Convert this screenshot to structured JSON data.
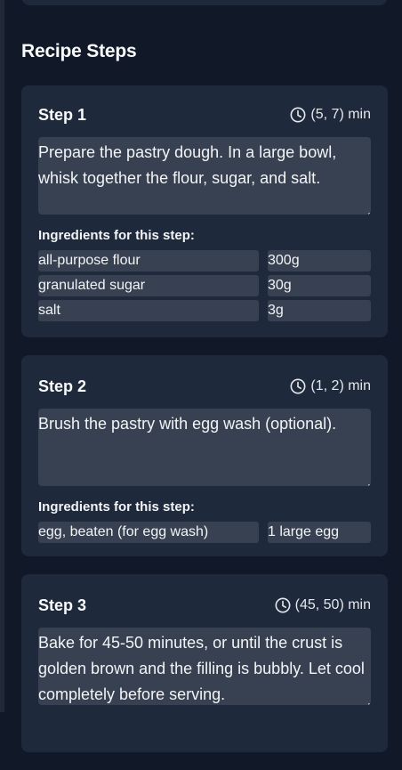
{
  "recipe_steps": {
    "title": "Recipe Steps",
    "ingredients_heading": "Ingredients for this step:",
    "steps": [
      {
        "title": "Step 1",
        "time": "(5, 7) min",
        "description": "Prepare the pastry dough. In a large bowl, whisk together the flour, sugar, and salt.",
        "ingredients": [
          {
            "name": "all-purpose flour",
            "quantity": "300g"
          },
          {
            "name": "granulated sugar",
            "quantity": "30g"
          },
          {
            "name": "salt",
            "quantity": "3g"
          }
        ]
      },
      {
        "title": "Step 2",
        "time": "(1, 2) min",
        "description": "Brush the pastry with egg wash (optional).",
        "ingredients": [
          {
            "name": "egg, beaten (for egg wash)",
            "quantity": "1 large egg"
          }
        ]
      },
      {
        "title": "Step 3",
        "time": "(45, 50) min",
        "description": "Bake for 45-50 minutes, or until the crust is golden brown and the filling is bubbly. Let cool completely before serving.",
        "ingredients": []
      }
    ]
  },
  "colors": {
    "background": "#111827",
    "card": "#1e293b",
    "field": "#374151",
    "text": "#f3f4f6"
  },
  "icons": {
    "time": "clock-icon"
  }
}
